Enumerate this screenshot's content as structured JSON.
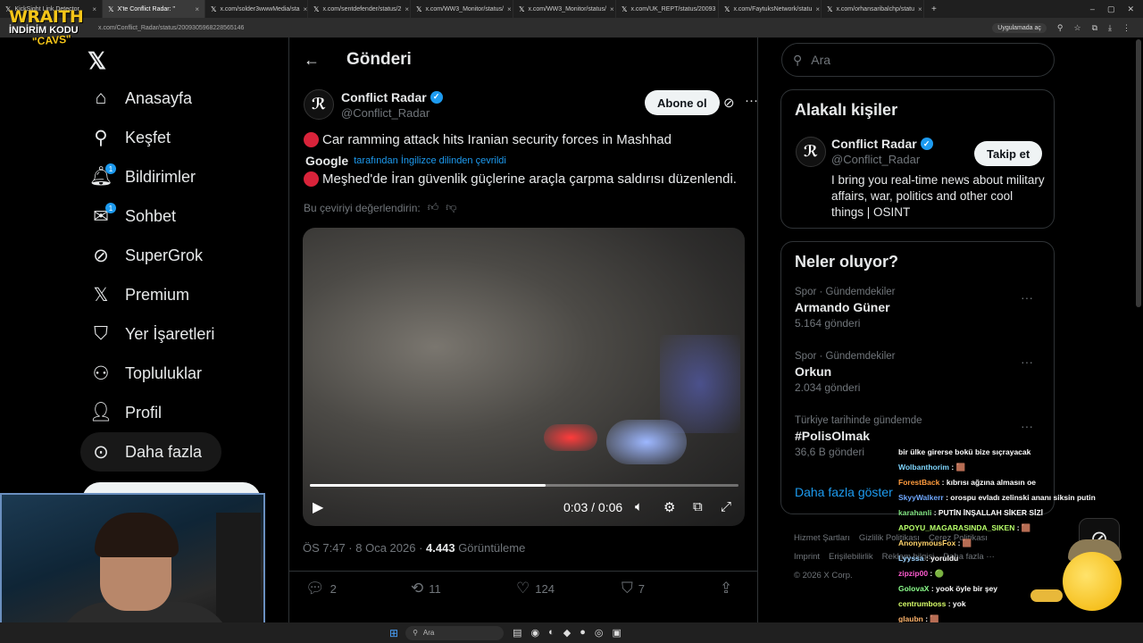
{
  "browser": {
    "tabs": [
      {
        "label": "KickSight Link Detector",
        "active": false
      },
      {
        "label": "X'te Conflict Radar: \"",
        "active": true
      },
      {
        "label": "x.com/solder3wwwMedia/sta",
        "active": false
      },
      {
        "label": "x.com/sentdefender/status/2",
        "active": false
      },
      {
        "label": "x.com/WW3_Monitor/status/",
        "active": false
      },
      {
        "label": "x.com/WW3_Monitor/status/",
        "active": false
      },
      {
        "label": "x.com/UK_REPT/status/20093",
        "active": false
      },
      {
        "label": "x.com/FaytuksNetwork/statu",
        "active": false
      },
      {
        "label": "x.com/orhansaribalchp/statu",
        "active": false
      }
    ],
    "url": "x.com/Conflict_Radar/status/2009305968228565146",
    "apps_label": "Uygulamada aç"
  },
  "overlay": {
    "brand": "WRAITH",
    "promo": "İNDİRİM KODU",
    "code": "\"CAVS\""
  },
  "nav": {
    "items": [
      {
        "label": "Anasayfa",
        "icon": "home-icon",
        "glyph": "⌂"
      },
      {
        "label": "Keşfet",
        "icon": "search-icon",
        "glyph": "⚲"
      },
      {
        "label": "Bildirimler",
        "icon": "bell-icon",
        "glyph": "🔔︎",
        "badge": "1"
      },
      {
        "label": "Sohbet",
        "icon": "mail-icon",
        "glyph": "✉",
        "badge": "1"
      },
      {
        "label": "SuperGrok",
        "icon": "grok-icon",
        "glyph": "⊘"
      },
      {
        "label": "Premium",
        "icon": "x-premium-icon",
        "glyph": "𝕏"
      },
      {
        "label": "Yer İşaretleri",
        "icon": "bookmark-icon",
        "glyph": "⛉"
      },
      {
        "label": "Topluluklar",
        "icon": "communities-icon",
        "glyph": "⚇"
      },
      {
        "label": "Profil",
        "icon": "profile-icon",
        "glyph": "👤︎"
      },
      {
        "label": "Daha fazla",
        "icon": "more-circle-icon",
        "glyph": "⊙"
      }
    ]
  },
  "post": {
    "header_title": "Gönderi",
    "author_name": "Conflict Radar",
    "author_handle": "@Conflict_Radar",
    "subscribe_label": "Abone ol",
    "text_original": "Car ramming attack hits Iranian security forces in Mashhad",
    "translated_by_brand": "Google",
    "translated_by_text": "tarafından İngilizce dilinden çevrildi",
    "text_translated": "Meşhed'de İran güvenlik güçlerine araçla çarpma saldırısı düzenlendi.",
    "rate_translation": "Bu çeviriyi değerlendirin:",
    "video": {
      "time_current": "0:03",
      "time_total": "0:06",
      "progress": 0.55
    },
    "timestamp": "ÖS 7:47 · 8 Oca 2026 · ",
    "views_count": "4.443",
    "views_label": " Görüntüleme",
    "stats": {
      "replies": "2",
      "reposts": "11",
      "likes": "124",
      "bookmarks": "7"
    }
  },
  "sidebar": {
    "search_placeholder": "Ara",
    "related_title": "Alakalı kişiler",
    "related_user": {
      "name": "Conflict Radar",
      "handle": "@Conflict_Radar",
      "bio": "I bring you real-time news about military affairs, war, politics and other cool things | OSINT",
      "follow_label": "Takip et"
    },
    "trends_title": "Neler oluyor?",
    "trends": [
      {
        "category": "Spor · Gündemdekiler",
        "name": "Armando Güner",
        "count": "5.164 gönderi"
      },
      {
        "category": "Spor · Gündemdekiler",
        "name": "Orkun",
        "count": "2.034 gönderi"
      },
      {
        "category": "Türkiye tarihinde gündemde",
        "name": "#PolisOlmak",
        "count": "36,6 B gönderi"
      }
    ],
    "show_more": "Daha fazla göster",
    "footer": [
      "Hizmet Şartları",
      "Gizlilik Politikası",
      "Çerez Politikası",
      "Imprint",
      "Erişilebilirlik",
      "Reklam bilgisi",
      "Daha fazla ···",
      "© 2026 X Corp."
    ]
  },
  "chat": [
    {
      "user": "",
      "msg": "bir ülke girerse bokü bize sıçrayacak",
      "color": "#ffffff"
    },
    {
      "user": "Wolbanthorim",
      "msg": " : 🟫",
      "color": "#7fd6ff"
    },
    {
      "user": "ForestBack",
      "msg": " : kıbrısı ağzına almasın oe",
      "color": "#ff9b3d"
    },
    {
      "user": "SkyyWalkerr",
      "msg": " : orospu evladı zelinski ananı siksin putin",
      "color": "#6fa8ff"
    },
    {
      "user": "karahanli",
      "msg": " : PUTİN İNŞALLAH SİKER SİZİ",
      "color": "#7fe07f"
    },
    {
      "user": "APOYU_MAGARASINDA_SIKEN",
      "msg": " : 🟫",
      "color": "#b7ff6a"
    },
    {
      "user": "AnonymousFox",
      "msg": " : 🟫",
      "color": "#ffd36b"
    },
    {
      "user": "Lyyssa",
      "msg": " : yoruldu",
      "color": "#9fd4ff"
    },
    {
      "user": "zipzip00",
      "msg": " : 🟢",
      "color": "#ff5bd0"
    },
    {
      "user": "GolovaX",
      "msg": " : yook öyle bir şey",
      "color": "#8cff8c"
    },
    {
      "user": "centrumboss",
      "msg": " : yok",
      "color": "#d9ff6a"
    },
    {
      "user": "glaubn",
      "msg": " : 🟫",
      "color": "#ffb36b"
    },
    {
      "user": "Juessaa",
      "msg": " : 🟫",
      "color": "#7fd4ff"
    }
  ],
  "taskbar": {
    "search_label": "Ara"
  }
}
